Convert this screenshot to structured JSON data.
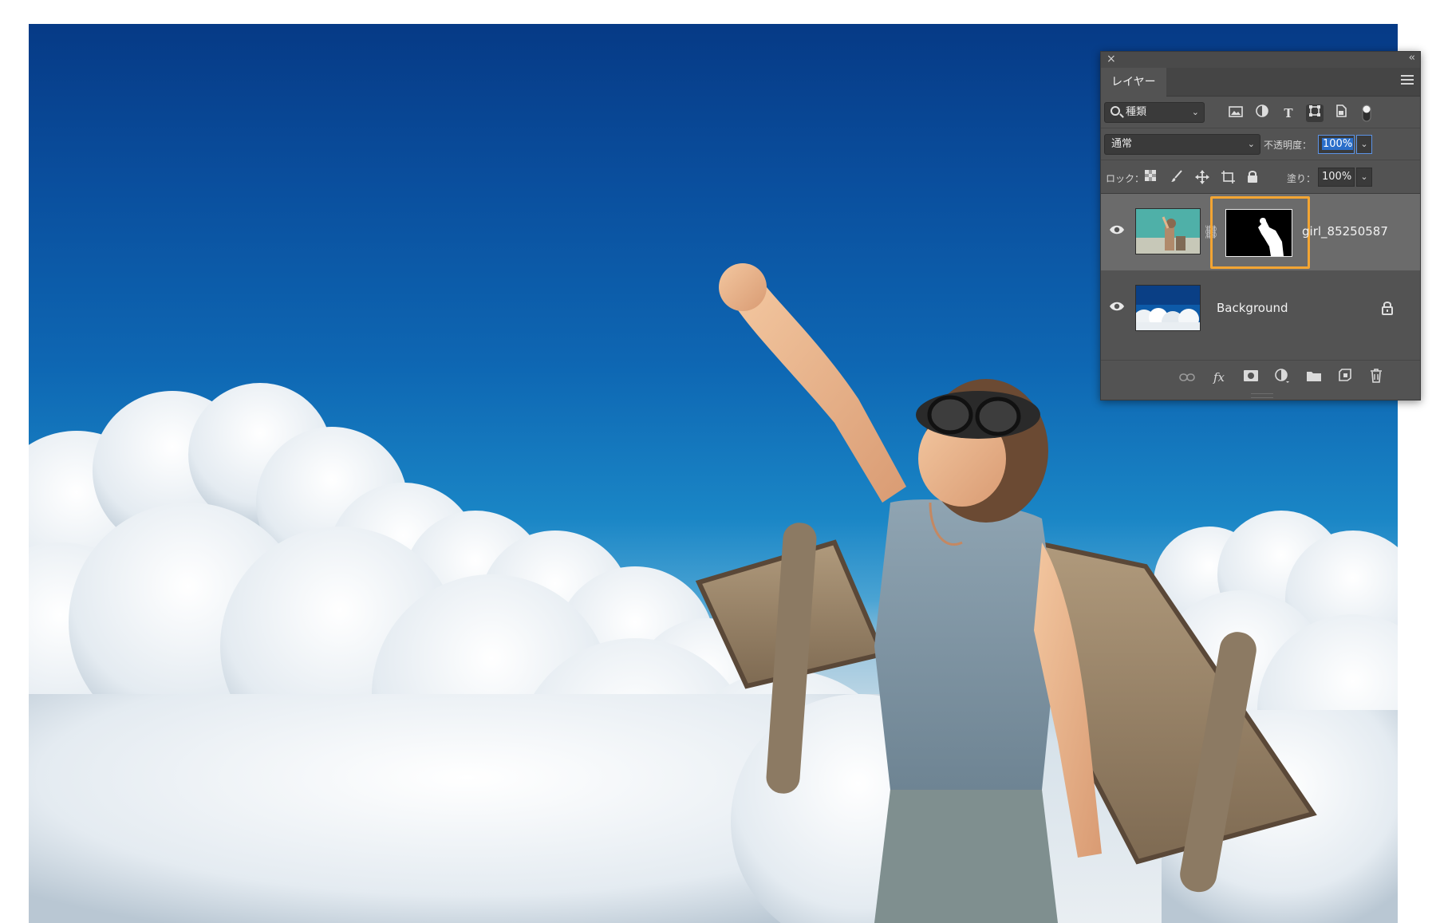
{
  "panel": {
    "close_glyph": "×",
    "collapse_glyph": "‹‹",
    "tab_label": "レイヤー",
    "menu_icon": "panel-menu-icon"
  },
  "filter": {
    "kind_label": "種類",
    "icons": [
      "pixel-layer-filter-icon",
      "adjustment-layer-filter-icon",
      "type-layer-filter-icon",
      "shape-layer-filter-icon",
      "smart-object-filter-icon",
      "filter-toggle-icon"
    ]
  },
  "blend": {
    "mode_label": "通常",
    "opacity_label": "不透明度：",
    "opacity_value": "100%"
  },
  "lock": {
    "label": "ロック：",
    "fill_label": "塗り：",
    "fill_value": "100%",
    "icons": [
      "lock-transparent-pixels-icon",
      "lock-image-pixels-icon",
      "lock-position-icon",
      "lock-artboard-icon",
      "lock-all-icon"
    ]
  },
  "layers": [
    {
      "name": "girl_85250587",
      "visible": true,
      "selected": true,
      "has_mask": true,
      "mask_highlighted": true
    },
    {
      "name": "Background",
      "visible": true,
      "selected": false,
      "locked": true
    }
  ],
  "bottom_icons": [
    "link-layers-icon",
    "fx-icon",
    "add-mask-icon",
    "new-adjustment-icon",
    "new-group-icon",
    "new-layer-icon",
    "delete-layer-icon"
  ],
  "bottom_labels": {
    "fx": "fx"
  },
  "colors": {
    "mask_highlight": "#f3a533",
    "panel_bg": "#535353",
    "selected_row": "#6b6b6b"
  }
}
